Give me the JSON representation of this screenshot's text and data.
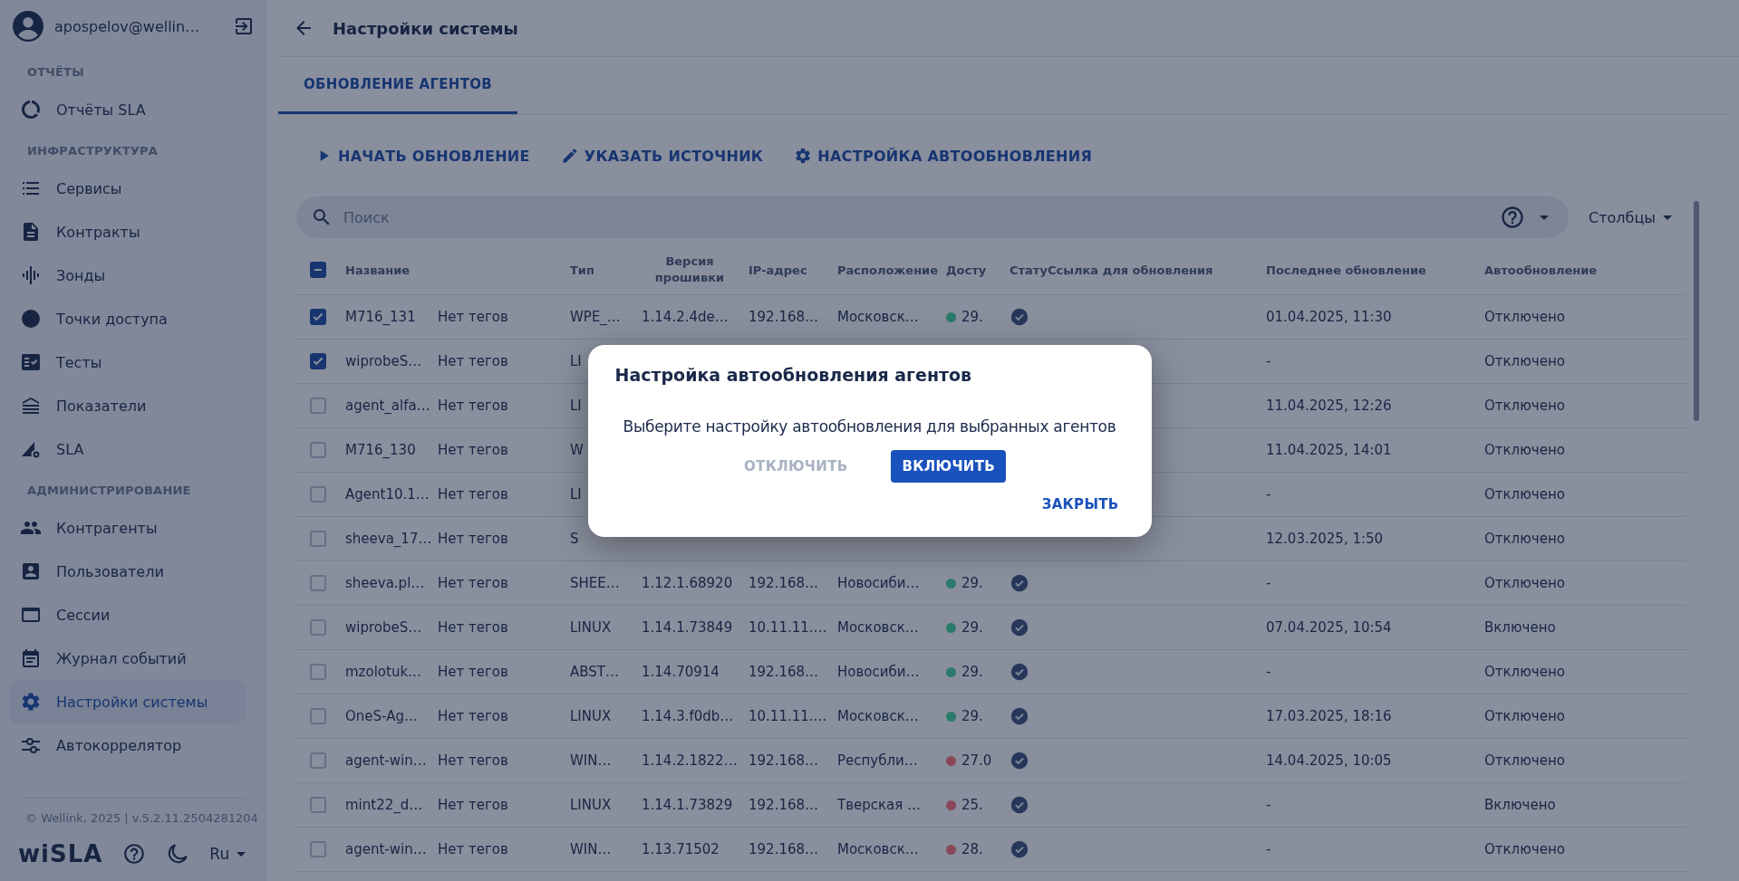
{
  "user": {
    "email": "apospelov@wellin…"
  },
  "sidebar": {
    "sections": [
      {
        "title": "ОТЧЁТЫ",
        "items": [
          {
            "label": "Отчёты SLA",
            "selected": false
          }
        ]
      },
      {
        "title": "ИНФРАСТРУКТУРА",
        "items": [
          {
            "label": "Сервисы",
            "selected": false
          },
          {
            "label": "Контракты",
            "selected": false
          },
          {
            "label": "Зонды",
            "selected": false
          },
          {
            "label": "Точки доступа",
            "selected": false
          },
          {
            "label": "Тесты",
            "selected": false
          },
          {
            "label": "Показатели",
            "selected": false
          },
          {
            "label": "SLA",
            "selected": false
          }
        ]
      },
      {
        "title": "АДМИНИСТРИРОВАНИЕ",
        "items": [
          {
            "label": "Контрагенты",
            "selected": false
          },
          {
            "label": "Пользователи",
            "selected": false
          },
          {
            "label": "Сессии",
            "selected": false
          },
          {
            "label": "Журнал событий",
            "selected": false
          },
          {
            "label": "Настройки системы",
            "selected": true
          },
          {
            "label": "Автокоррелятор",
            "selected": false
          }
        ]
      }
    ],
    "copyright": "© Wellink, 2025 | v.5.2.11.2504281204",
    "logo": "wiSLA",
    "language": "Ru"
  },
  "page": {
    "title": "Настройки системы"
  },
  "tabs": [
    {
      "label": "ОБНОВЛЕНИЕ АГЕНТОВ",
      "selected": true
    }
  ],
  "actions": [
    "НАЧАТЬ ОБНОВЛЕНИЕ",
    "УКАЗАТЬ ИСТОЧНИК",
    "НАСТРОЙКА АВТООБНОВЛЕНИЯ"
  ],
  "search": {
    "placeholder": "Поиск"
  },
  "columns_button": "Столбцы",
  "table": {
    "header_checkbox": {
      "indeterminate": true
    },
    "columns": [
      "Название",
      "",
      "Тип",
      "Версия прошивки",
      "IP-адрес",
      "Расположение",
      "Досту",
      "Стату",
      "Ссылка для обновления",
      "Последнее обновление",
      "Автообновление"
    ],
    "rows": [
      {
        "selected": true,
        "name": "M716_131",
        "tags": "Нет тегов",
        "type": "WPE_…",
        "firmware": "1.14.2.4de…",
        "ip": "192.168…",
        "location": "Московск…",
        "color": "#2b7a6a",
        "access": "29.",
        "last_update": "01.04.2025, 11:30",
        "auto": "Отключено"
      },
      {
        "selected": true,
        "name": "wiprobeS…",
        "tags": "Нет тегов",
        "type": "LI",
        "last_update": "-",
        "auto": "Отключено"
      },
      {
        "selected": false,
        "name": "agent_alfa…",
        "tags": "Нет тегов",
        "type": "LI",
        "last_update": "11.04.2025, 12:26",
        "auto": "Отключено"
      },
      {
        "selected": false,
        "name": "M716_130",
        "tags": "Нет тегов",
        "type": "W",
        "last_update": "11.04.2025, 14:01",
        "auto": "Отключено"
      },
      {
        "selected": false,
        "name": "Agent10.1…",
        "tags": "Нет тегов",
        "type": "LI",
        "last_update": "-",
        "auto": "Отключено"
      },
      {
        "selected": false,
        "name": "sheeva_17…",
        "tags": "Нет тегов",
        "type": "S",
        "last_update": "12.03.2025, 1:50",
        "auto": "Отключено"
      },
      {
        "selected": false,
        "name": "sheeva.pl…",
        "tags": "Нет тегов",
        "type": "SHEE…",
        "firmware": "1.12.1.68920",
        "ip": "192.168…",
        "location": "Новосиби…",
        "color": "#2b7a6a",
        "access": "29.",
        "last_update": "-",
        "auto": "Отключено"
      },
      {
        "selected": false,
        "name": "wiprobeS…",
        "tags": "Нет тегов",
        "type": "LINUX",
        "firmware": "1.14.1.73849",
        "ip": "10.11.11.…",
        "location": "Московск…",
        "color": "#2b7a6a",
        "access": "29.",
        "last_update": "07.04.2025, 10:54",
        "auto": "Включено"
      },
      {
        "selected": false,
        "name": "mzolotuk…",
        "tags": "Нет тегов",
        "type": "ABST…",
        "firmware": "1.14.70914",
        "ip": "192.168…",
        "location": "Новосиби…",
        "color": "#2b7a6a",
        "access": "29.",
        "last_update": "-",
        "auto": "Отключено"
      },
      {
        "selected": false,
        "name": "OneS-Ag…",
        "tags": "Нет тегов",
        "type": "LINUX",
        "firmware": "1.14.3.f0db…",
        "ip": "10.11.11.…",
        "location": "Московск…",
        "color": "#2b7a6a",
        "access": "29.",
        "last_update": "17.03.2025, 18:16",
        "auto": "Отключено"
      },
      {
        "selected": false,
        "name": "agent-win…",
        "tags": "Нет тегов",
        "type": "WIN…",
        "firmware": "1.14.2.1822…",
        "ip": "192.168…",
        "location": "Республи…",
        "color": "#884858",
        "access": "27.0",
        "last_update": "14.04.2025, 10:05",
        "auto": "Отключено"
      },
      {
        "selected": false,
        "name": "mint22_d…",
        "tags": "Нет тегов",
        "type": "LINUX",
        "firmware": "1.14.1.73829",
        "ip": "192.168…",
        "location": "Тверская …",
        "color": "#884858",
        "access": "25.",
        "last_update": "-",
        "auto": "Включено"
      },
      {
        "selected": false,
        "name": "agent-win…",
        "tags": "Нет тегов",
        "type": "WIN…",
        "firmware": "1.13.71502",
        "ip": "192.168…",
        "location": "Московск…",
        "color": "#884858",
        "access": "28.",
        "last_update": "-",
        "auto": "Отключено"
      }
    ]
  },
  "dialog": {
    "title": "Настройка автообновления агентов",
    "message": "Выберите настройку автообновления для выбранных агентов",
    "buttons": [
      {
        "label": "ОТКЛЮЧИТЬ",
        "kind": "text",
        "disabled": true
      },
      {
        "label": "ВКЛЮЧИТЬ",
        "kind": "contained",
        "disabled": false
      }
    ],
    "close": "ЗАКРЫТЬ"
  }
}
